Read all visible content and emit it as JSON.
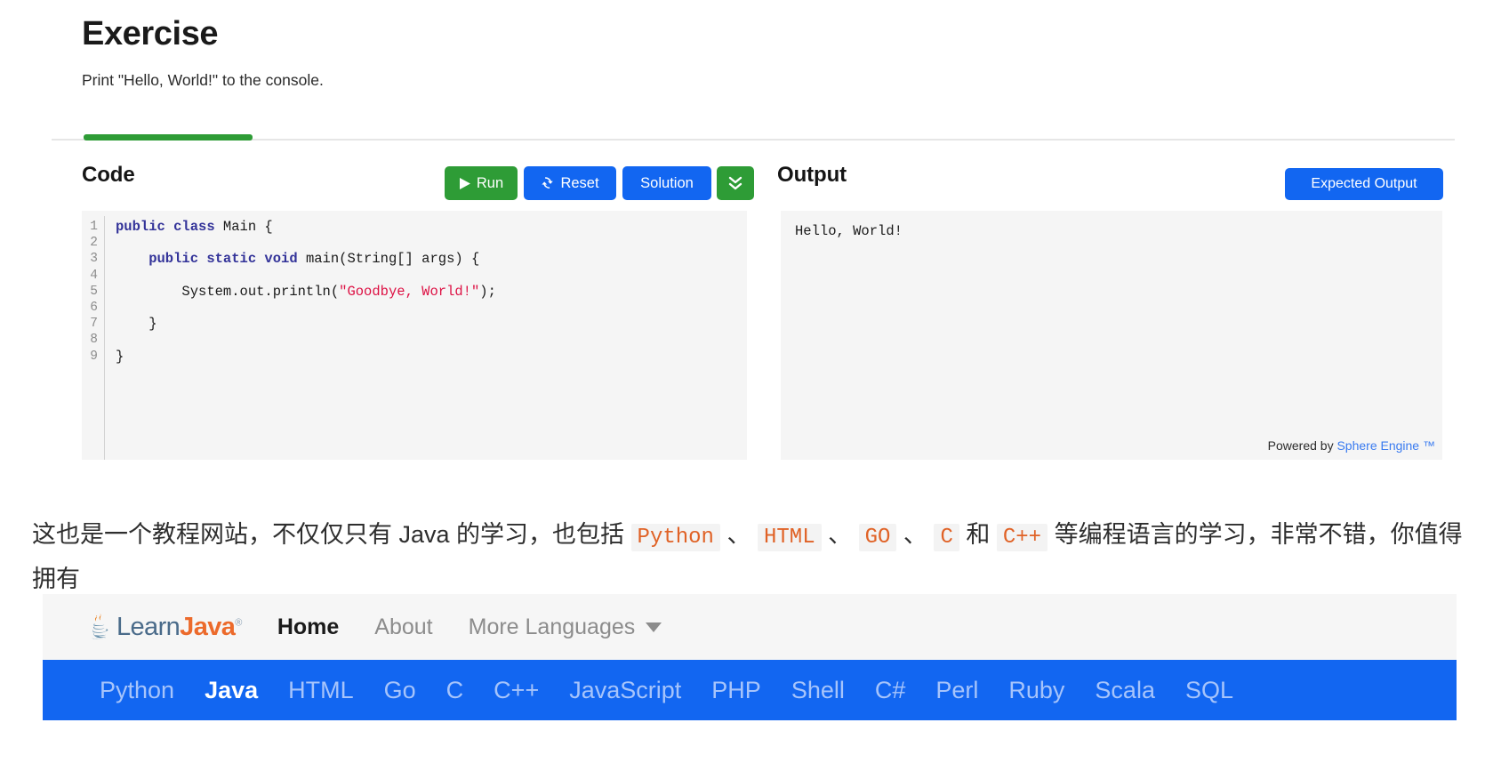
{
  "exercise": {
    "title": "Exercise",
    "description": "Print \"Hello, World!\" to the console."
  },
  "code_panel": {
    "heading": "Code",
    "buttons": {
      "run": "Run",
      "reset": "Reset",
      "solution": "Solution",
      "expand": ""
    },
    "icons": {
      "run": "play-icon",
      "reset": "refresh-icon",
      "expand": "double-chevron-down-icon"
    },
    "line_numbers": [
      "1",
      "2",
      "3",
      "4",
      "5",
      "6",
      "7",
      "8",
      "9"
    ],
    "code_lines": [
      [
        {
          "t": "public class ",
          "c": "kw"
        },
        {
          "t": "Main {",
          "c": "pl"
        }
      ],
      [],
      [
        {
          "t": "    public static void ",
          "c": "kw"
        },
        {
          "t": "main(String[] args) {",
          "c": "pl"
        }
      ],
      [],
      [
        {
          "t": "        System.out.println(",
          "c": "pl"
        },
        {
          "t": "\"Goodbye, World!\"",
          "c": "str"
        },
        {
          "t": ");",
          "c": "pl"
        }
      ],
      [],
      [
        {
          "t": "    }",
          "c": "pl"
        }
      ],
      [],
      [
        {
          "t": "}",
          "c": "pl"
        }
      ]
    ]
  },
  "output_panel": {
    "heading": "Output",
    "expected_button": "Expected Output",
    "output_text": "Hello, World!",
    "credit_prefix": "Powered by ",
    "credit_link": "Sphere Engine ™"
  },
  "commentary": {
    "seg1": "这也是一个教程网站，不仅仅只有 Java 的学习，也包括 ",
    "code1": "Python",
    "seg2": " 、 ",
    "code2": "HTML",
    "seg3": " 、 ",
    "code3": "GO",
    "seg4": " 、 ",
    "code4": "C",
    "seg5": " 和 ",
    "code5": "C++",
    "seg6": " 等编程语言的学习，非常不错，你值得拥有"
  },
  "navbar": {
    "brand_learn": "Learn",
    "brand_java": "Java",
    "brand_tm": "®",
    "brand_icon": "java-cup-icon",
    "links": [
      {
        "label": "Home",
        "active": true
      },
      {
        "label": "About",
        "active": false
      },
      {
        "label": "More Languages",
        "active": false,
        "has_caret": true
      }
    ]
  },
  "langbar": {
    "languages": [
      {
        "label": "Python",
        "active": false
      },
      {
        "label": "Java",
        "active": true
      },
      {
        "label": "HTML",
        "active": false
      },
      {
        "label": "Go",
        "active": false
      },
      {
        "label": "C",
        "active": false
      },
      {
        "label": "C++",
        "active": false
      },
      {
        "label": "JavaScript",
        "active": false
      },
      {
        "label": "PHP",
        "active": false
      },
      {
        "label": "Shell",
        "active": false
      },
      {
        "label": "C#",
        "active": false
      },
      {
        "label": "Perl",
        "active": false
      },
      {
        "label": "Ruby",
        "active": false
      },
      {
        "label": "Scala",
        "active": false
      },
      {
        "label": "SQL",
        "active": false
      }
    ]
  },
  "colors": {
    "green": "#2e9c36",
    "blue": "#1266f1",
    "orange": "#ec6a2b",
    "code_string": "#dd1144",
    "code_keyword": "#333399"
  }
}
